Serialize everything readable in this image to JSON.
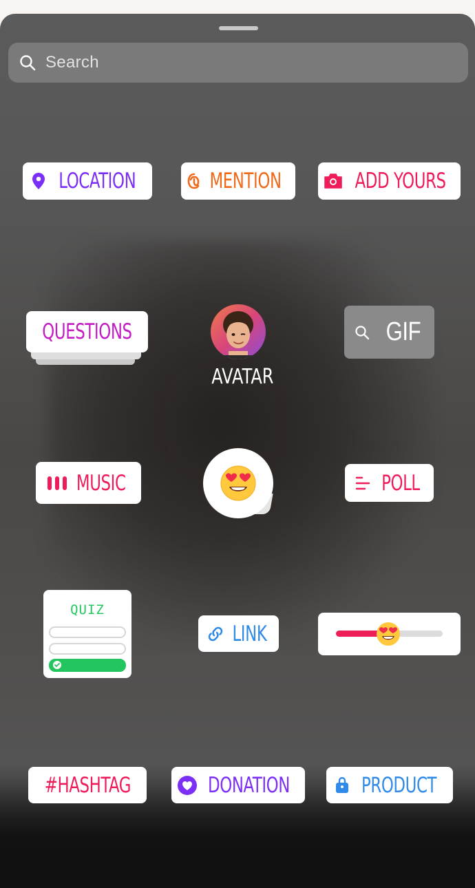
{
  "search": {
    "placeholder": "Search",
    "icon": "search-icon"
  },
  "stickers": {
    "location": {
      "label": "LOCATION",
      "color": "#7b2ff7",
      "icon": "location-pin-icon"
    },
    "mention": {
      "label": "MENTION",
      "color": "#f06a1a",
      "icon": "threads-at-icon"
    },
    "add_yours": {
      "label": "ADD YOURS",
      "color": "#ee1d5a",
      "icon": "camera-icon"
    },
    "questions": {
      "label": "QUESTIONS",
      "color": "#c21cc4"
    },
    "avatar": {
      "label": "AVATAR"
    },
    "gif": {
      "label": "GIF",
      "icon": "search-icon"
    },
    "music": {
      "label": "MUSIC",
      "color": "#ee1d5a",
      "icon": "music-bars-icon"
    },
    "emoji": {
      "glyph": "😍"
    },
    "poll": {
      "label": "POLL",
      "color": "#ee1d5a",
      "icon": "poll-lines-icon"
    },
    "quiz": {
      "label": "QUIZ",
      "color": "#22c55e"
    },
    "link": {
      "label": "LINK",
      "color": "#2f8ae8",
      "icon": "link-icon"
    },
    "slider": {
      "emoji": "😍",
      "level": 0.5,
      "color": "#ee1d5a"
    },
    "hashtag": {
      "label": "#HASHTAG",
      "color": "#ee1d5a"
    },
    "donation": {
      "label": "DONATION",
      "color": "#7b2ff7",
      "icon": "heart-icon"
    },
    "product": {
      "label": "PRODUCT",
      "color": "#2f8ae8",
      "icon": "shopping-bag-icon"
    }
  }
}
